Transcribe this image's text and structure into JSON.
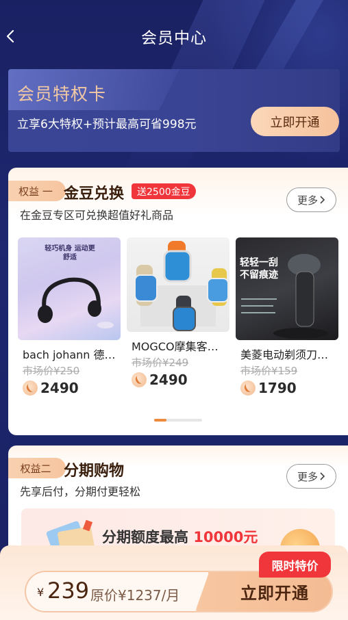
{
  "header": {
    "title": "会员中心",
    "back_icon": "chevron-left-icon"
  },
  "vip_card": {
    "title": "会员特权卡",
    "subtitle": "立享6大特权+预计最高可省998元",
    "button": "立即开通"
  },
  "section1": {
    "tag": "权益 一",
    "title": "金豆兑换",
    "badge": "送2500金豆",
    "desc": "在金豆专区可兑换超值好礼商品",
    "more": "更多",
    "products": [
      {
        "name": "bach johann 德…",
        "market_price": "市场价¥250",
        "beans": "2490",
        "img_caption": "轻巧机身 运动更舒适"
      },
      {
        "name": "MOGCO摩集客…",
        "market_price": "市场价¥249",
        "beans": "2490"
      },
      {
        "name": "美菱电动剃须刀…",
        "market_price": "市场价¥159",
        "beans": "1790",
        "img_caption": "轻轻一刮 不留痕迹"
      }
    ]
  },
  "section2": {
    "tag": "权益二",
    "title": "分期购物",
    "desc": "先享后付，分期付更轻松",
    "more": "更多",
    "banner_text": "分期额度最高",
    "banner_amount": "10000元"
  },
  "bottom_bar": {
    "currency": "¥",
    "price": "239",
    "original": "原价¥1237/月",
    "button": "立即开通",
    "limit_badge": "限时特价"
  },
  "colors": {
    "background": "#1b2366",
    "accent_gold": "#f5c29c",
    "badge_red": "#f0363b"
  }
}
